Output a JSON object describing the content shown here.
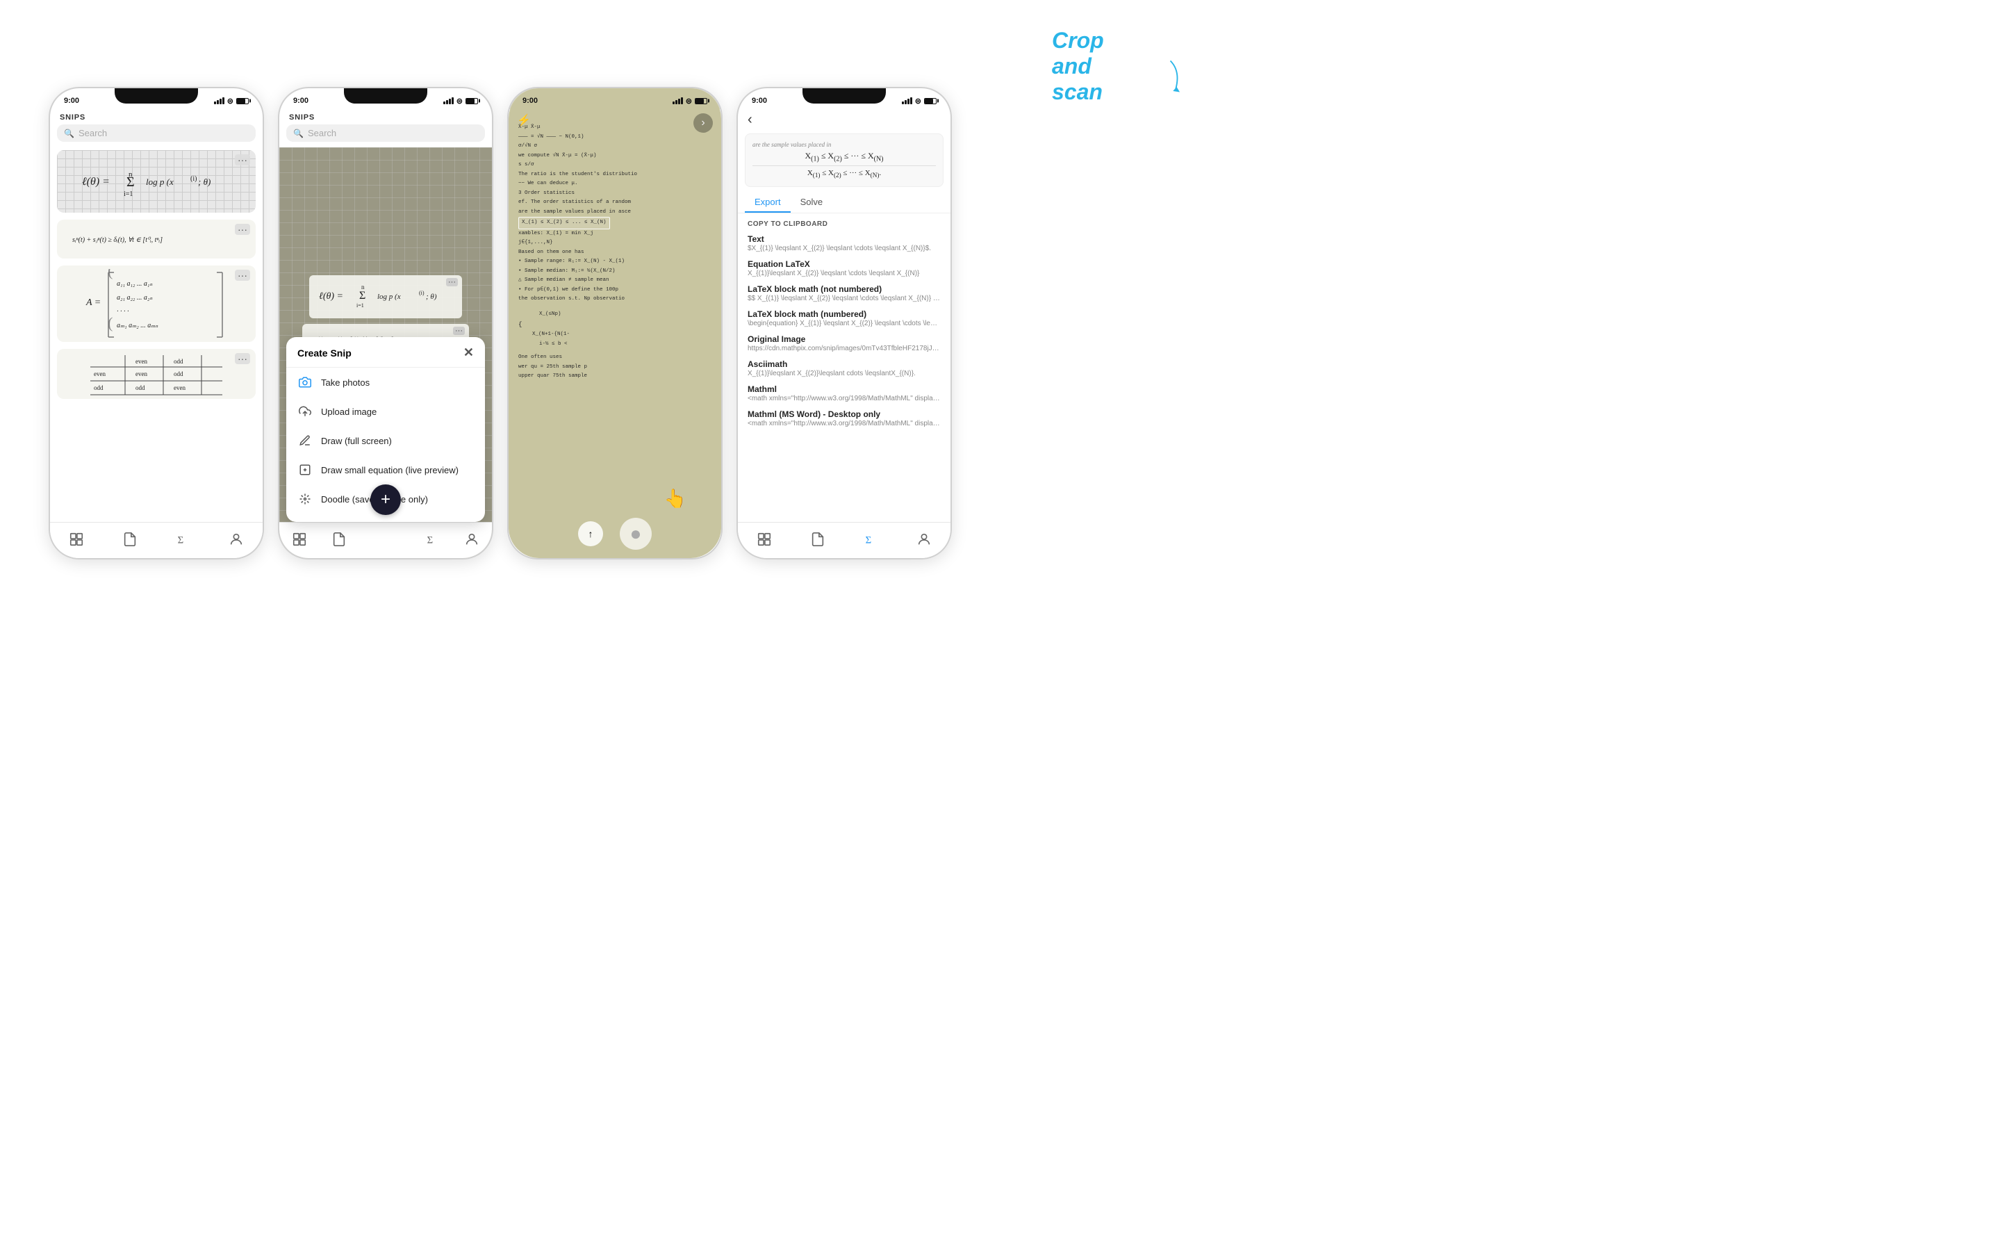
{
  "scene": {
    "crop_scan_label": "Crop and scan",
    "bg_color": "#ffffff"
  },
  "phone1": {
    "time": "9:00",
    "section_label": "SNIPS",
    "search_placeholder": "Search",
    "snip_cards": [
      {
        "formula": "ℓ(θ) = Σ log p(x⁽ⁱ⁾; θ)",
        "has_dots": true
      },
      {
        "formula": "sᵢⁿ(t) + sⱼⁿ(t) ≥ δᵢ(t), ∀t ∈ [t⁰ᵢ, tⁿᵢ]",
        "has_dots": true
      },
      {
        "formula": "A = (matrix)",
        "has_dots": true
      }
    ],
    "bottom_nav": [
      "snips-icon",
      "pdf-icon",
      "formula-icon",
      "profile-icon"
    ]
  },
  "phone2": {
    "time": "9:00",
    "section_label": "SNIPS",
    "search_placeholder": "Search",
    "popup": {
      "title": "Create Snip",
      "items": [
        {
          "icon": "camera",
          "label": "Take photos"
        },
        {
          "icon": "upload",
          "label": "Upload image"
        },
        {
          "icon": "draw",
          "label": "Draw (full screen)"
        },
        {
          "icon": "draw-small",
          "label": "Draw small equation (live preview)"
        },
        {
          "icon": "doodle",
          "label": "Doodle (saves image only)"
        }
      ]
    }
  },
  "phone3": {
    "time": "9:00",
    "lines": [
      "X̄-μ        X̄-μ",
      "——— = √N ——— ~ N(0,1)",
      "σ/√N       σ",
      "we compute √N X̄-μ = (X̄-μ)",
      "                s         s/σ",
      "The ratio is the student's distributio",
      "~~ We can deduce μ.",
      "3  Order statistics",
      "ef. The order statistics of a random",
      "are the sample values placed in asce",
      "X_(1) ≤ X_(2) ≤ ... ≤ X_(N)",
      "xambles: X_(1) = min  X_j",
      "                    j∈{1,...,N}",
      "Based on them one has",
      "• Sample range:  R₁:= X_(N) - X_(1)",
      "• Sample median: M₁:= {formula}",
      "△ Sample median ≠ sample mean",
      "• For p∈(0,1) we define the 100p"
    ],
    "selection_text": "X_(1) ≤ X_(2) ≤ ... ≤ X_(N)"
  },
  "phone4": {
    "time": "9:00",
    "preview_formula": "X_(1) ≤ X_(2) ≤ ··· ≤ X_(N)",
    "preview_formula2": "X_(1) ≤ X_(2) ≤ ··· ≤ X_(N).",
    "tabs": [
      "Export",
      "Solve"
    ],
    "active_tab": "Export",
    "copy_label": "COPY TO CLIPBOARD",
    "export_items": [
      {
        "title": "Text",
        "value": "$X_{(1)} \\leqslant X_{(2)} \\leqslant \\cdots \\leqslant X_{(N)}$."
      },
      {
        "title": "Equation LaTeX",
        "value": "X_{(1)}\\leqslant X_{(2)} \\leqslant \\cdots \\leqslant X_{(N)}"
      },
      {
        "title": "LaTeX block math (not numbered)",
        "value": "$$ X_{(1)} \\leqslant X_{(2)} \\leqslant \\cdots \\leqslant X_{(N)} . $$"
      },
      {
        "title": "LaTeX block math (numbered)",
        "value": "\\begin{equation} X_{(1)} \\leqslant X_{(2)} \\leqslant \\cdots \\leqslant X_{(N)} . ..."
      },
      {
        "title": "Original Image",
        "value": "https://cdn.mathpix.com/snip/images/0mTv43TfbleHF2178jJWFChmblcR4..."
      },
      {
        "title": "Asciimath",
        "value": "X_{(1)}\\leqslant X_{(2)}\\leqslant cdots \\leqslantX_{(N)}."
      },
      {
        "title": "Mathml",
        "value": "<math xmlns=\"http://www.w3.org/1998/Math/MathML\" display=\"block\"> <..."
      },
      {
        "title": "Mathml (MS Word) - Desktop only",
        "value": "<math xmlns=\"http://www.w3.org/1998/Math/MathML\" display=\"block\"> <..."
      }
    ]
  }
}
